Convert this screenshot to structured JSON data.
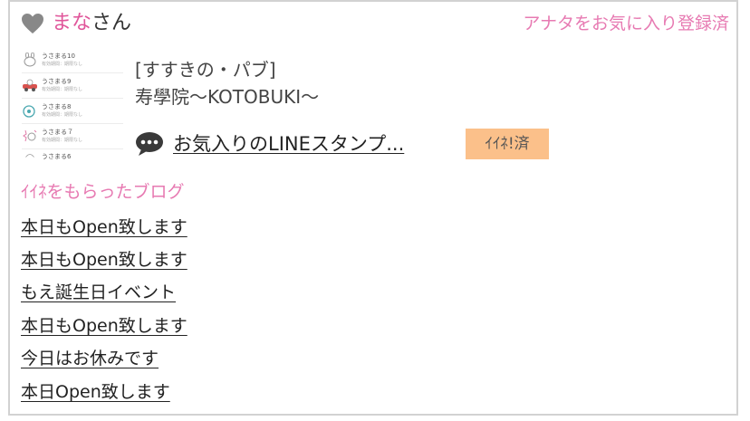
{
  "header": {
    "user_name": "まな",
    "user_suffix": "さん",
    "favorite_status": "アナタをお気に入り登録済",
    "heart_color": "#888888"
  },
  "thumbnail": {
    "items": [
      {
        "title": "うさまる10",
        "sub": "有効期間：期限なし",
        "icon": "rabbit-face-icon"
      },
      {
        "title": "うさまる9",
        "sub": "有効期間：期限なし",
        "icon": "rabbit-car-icon"
      },
      {
        "title": "うさまる8",
        "sub": "有効期間：期限なし",
        "icon": "rabbit-round-icon"
      },
      {
        "title": "うさまる７",
        "sub": "有効期間：期限なし",
        "icon": "rabbit-sparkle-icon"
      },
      {
        "title": "うさまる6",
        "sub": "",
        "icon": "rabbit-face-icon"
      }
    ]
  },
  "shop": {
    "area": "[すすきの・パブ]",
    "name": "寿學院〜KOTOBUKI〜"
  },
  "stamp": {
    "link_text": "お気入りのLINEスタンプ...",
    "iine_badge": "ｲｲﾈ!済",
    "badge_color": "#fbc08a"
  },
  "blogs": {
    "section_title": "ｲｲﾈをもらったブログ",
    "items": [
      "本日もOpen致します",
      "本日もOpen致します",
      "もえ誕生日イベント",
      "本日もOpen致します",
      "今日はお休みです",
      "本日Open致します"
    ]
  },
  "colors": {
    "accent_pink": "#e77ab2",
    "name_pink": "#e0559a",
    "border": "#d2d2d2"
  }
}
